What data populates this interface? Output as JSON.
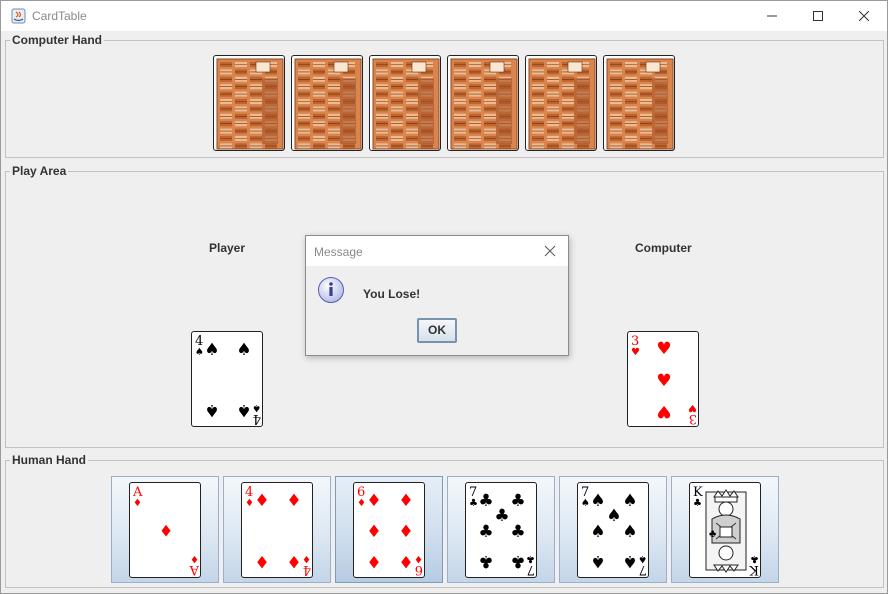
{
  "window": {
    "title": "CardTable"
  },
  "panels": {
    "computer_hand": "Computer Hand",
    "play_area": "Play Area",
    "human_hand": "Human Hand"
  },
  "play_area": {
    "player_label": "Player",
    "computer_label": "Computer",
    "player_card": {
      "rank": "4",
      "suit": "spades"
    },
    "computer_card": {
      "rank": "3",
      "suit": "hearts"
    }
  },
  "computer_hand": {
    "face_down_count": 6
  },
  "human_hand": {
    "cards": [
      {
        "rank": "A",
        "suit": "diamonds"
      },
      {
        "rank": "4",
        "suit": "diamonds"
      },
      {
        "rank": "6",
        "suit": "diamonds"
      },
      {
        "rank": "7",
        "suit": "clubs"
      },
      {
        "rank": "7",
        "suit": "spades"
      },
      {
        "rank": "K",
        "suit": "clubs"
      }
    ],
    "selected_index": 2
  },
  "dialog": {
    "title": "Message",
    "message": "You Lose!",
    "ok_label": "OK",
    "icon": "info-icon"
  },
  "colors": {
    "red_suit": "#ff0000",
    "black_suit": "#000000",
    "card_back": "#d9854d"
  }
}
